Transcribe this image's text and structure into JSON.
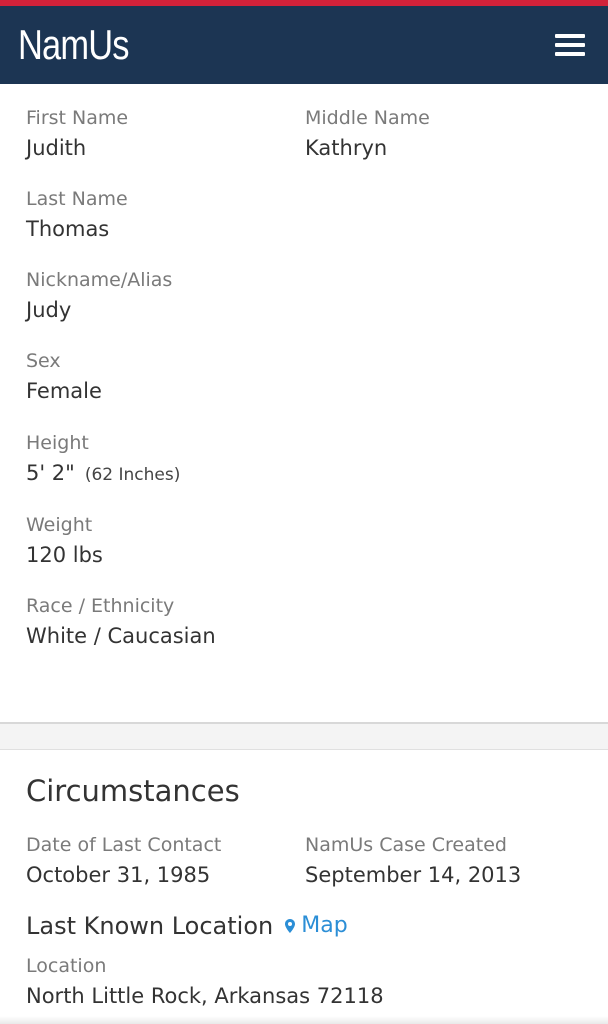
{
  "header": {
    "logo": "NamUs",
    "menu_icon": "hamburger-icon"
  },
  "person": {
    "first_name": {
      "label": "First Name",
      "value": "Judith"
    },
    "middle_name": {
      "label": "Middle Name",
      "value": "Kathryn"
    },
    "last_name": {
      "label": "Last Name",
      "value": "Thomas"
    },
    "nickname": {
      "label": "Nickname/Alias",
      "value": "Judy"
    },
    "sex": {
      "label": "Sex",
      "value": "Female"
    },
    "height": {
      "label": "Height",
      "value": "5' 2\"",
      "note": "(62 Inches)"
    },
    "weight": {
      "label": "Weight",
      "value": "120 lbs"
    },
    "race": {
      "label": "Race / Ethnicity",
      "value": "White / Caucasian"
    }
  },
  "circumstances": {
    "title": "Circumstances",
    "last_contact": {
      "label": "Date of Last Contact",
      "value": "October 31, 1985"
    },
    "case_created": {
      "label": "NamUs Case Created",
      "value": "September 14, 2013"
    },
    "last_known_location": {
      "title": "Last Known Location",
      "map_link": "Map",
      "location_label": "Location",
      "location_value": "North Little Rock, Arkansas 72118"
    }
  },
  "colors": {
    "brand_navy": "#1c3553",
    "brand_red": "#d2223a",
    "link_blue": "#2b8ed6"
  }
}
